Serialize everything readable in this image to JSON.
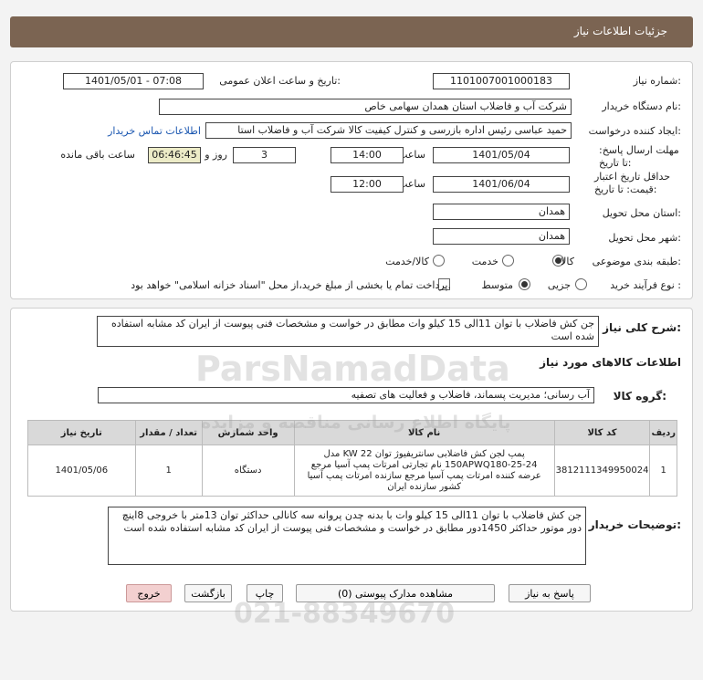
{
  "header": {
    "title": "جزئیات اطلاعات نیاز"
  },
  "info": {
    "need_number_label": "شماره نیاز:",
    "need_number": "1101007001000183",
    "announce_label": "تاریخ و ساعت اعلان عمومی:",
    "announce_value": "1401/05/01 - 07:08",
    "buyer_label": "نام دستگاه خریدار:",
    "buyer_value": "شرکت آب و فاضلاب استان همدان سهامی خاص",
    "creator_label": "ایجاد کننده درخواست:",
    "creator_value": "حمید عباسی رئیس اداره بازرسی و کنترل کیفیت کالا شرکت آب و فاضلاب استا",
    "contact_link": "اطلاعات تماس خریدار",
    "deadline_label": "مهلت ارسال پاسخ: تا تاریخ:",
    "deadline_date": "1401/05/04",
    "time_label": "ساعت",
    "deadline_time": "14:00",
    "days_value": "3",
    "days_label": "روز و",
    "remaining_time": "06:46:45",
    "remaining_label": "ساعت باقی مانده",
    "validity_label": "حداقل تاریخ اعتبار قیمت: تا تاریخ:",
    "validity_date": "1401/06/04",
    "validity_time": "12:00",
    "province_label": "استان محل تحویل:",
    "province_value": "همدان",
    "city_label": "شهر محل تحویل:",
    "city_value": "همدان",
    "category_label": "طبقه بندی موضوعی:",
    "category_options": [
      "کالا",
      "خدمت",
      "کالا/خدمت"
    ],
    "process_label": "نوع فرآیند خرید :",
    "process_options": [
      "جزیی",
      "متوسط"
    ],
    "payment_note": "پرداخت تمام یا بخشی از مبلغ خرید،از محل \"اسناد خزانه اسلامی\" خواهد بود."
  },
  "desc": {
    "summary_label": "شرح کلی نیاز:",
    "summary_value": "جن کش فاضلاب با توان 11الی 15 کیلو وات  مطابق در خواست و مشخصات فنی پیوست از ایران کد مشابه استفاده شده است",
    "goods_info_label": "اطلاعات کالاهای مورد نیاز",
    "group_label": "گروه کالا:",
    "group_value": "آب رسانی؛ مدیریت پسماند، فاضلاب و فعالیت های تصفیه",
    "table": {
      "headers": [
        "ردیف",
        "کد کالا",
        "نام کالا",
        "واحد شمارش",
        "تعداد / مقدار",
        "تاریخ نیاز"
      ],
      "rows": [
        {
          "row": "1",
          "code": "3812111349950024",
          "name": "پمپ لجن کش فاضلابی سانتریفیوژ توان 22 KW مدل 150APWQ180-25-24 نام تجارتی امرتات پمپ آسیا مرجع عرضه کننده امرتات پمپ آسیا مرجع سازنده امرتات پمپ آسیا کشور سازنده ایران",
          "unit": "دستگاه",
          "qty": "1",
          "date": "1401/05/06"
        }
      ]
    },
    "buyer_notes_label": "توضیحات خریدار:",
    "buyer_notes_value": "جن کش فاضلاب با توان 11الی 15 کیلو وات با بدنه چدن پروانه سه کانالی حداکثر توان 13متر با خروجی 8اینچ دور موتور حداکثر 1450دور مطابق در خواست و مشخصات فنی پیوست از ایران کد مشابه استفاده شده است"
  },
  "buttons": {
    "reply": "پاسخ به نیاز",
    "view_docs": "مشاهده مدارک پیوستی (0)",
    "print": "چاپ",
    "back": "بازگشت",
    "exit": "خروج"
  },
  "watermark": {
    "brand": "ParsNamadData",
    "persian": "پایگاه اطلاع رسانی مناقصه و مزایده",
    "phone": "021-88349670"
  }
}
